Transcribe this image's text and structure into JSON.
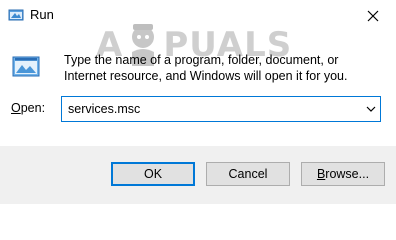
{
  "window": {
    "title": "Run",
    "close_icon": "close-icon"
  },
  "watermark": {
    "prefix": "A",
    "suffix": "PUALS"
  },
  "dialog": {
    "description": "Type the name of a program, folder, document, or Internet resource, and Windows will open it for you.",
    "open_label_accel": "O",
    "open_label_rest": "pen:",
    "open_value": "services.msc"
  },
  "buttons": {
    "ok": "OK",
    "cancel": "Cancel",
    "browse_accel": "B",
    "browse_rest": "rowse..."
  },
  "colors": {
    "accent": "#0078d7",
    "footer_bg": "#f0f0f0",
    "button_bg": "#e1e1e1"
  }
}
